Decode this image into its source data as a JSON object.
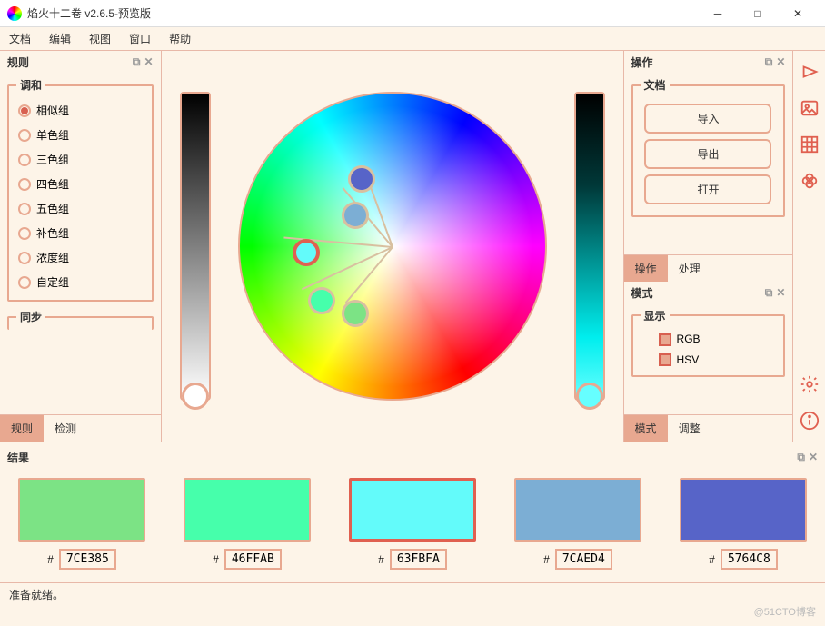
{
  "window": {
    "title": "焰火十二卷 v2.6.5-预览版"
  },
  "menu": {
    "file": "文档",
    "edit": "编辑",
    "view": "视图",
    "window": "窗口",
    "help": "帮助"
  },
  "rules": {
    "title": "规则",
    "harmony_legend": "调和",
    "options": [
      "相似组",
      "单色组",
      "三色组",
      "四色组",
      "五色组",
      "补色组",
      "浓度组",
      "自定组"
    ],
    "sync_legend": "同步",
    "tabs": {
      "rules": "规则",
      "detect": "检测"
    }
  },
  "ops": {
    "title": "操作",
    "doc_legend": "文档",
    "buttons": {
      "import": "导入",
      "export": "导出",
      "open": "打开"
    },
    "tabs": {
      "ops": "操作",
      "process": "处理"
    }
  },
  "mode": {
    "title": "模式",
    "display_legend": "显示",
    "rgb": "RGB",
    "hsv": "HSV",
    "tabs": {
      "mode": "模式",
      "adjust": "调整"
    }
  },
  "results": {
    "title": "结果",
    "swatches": [
      {
        "hex": "7CE385",
        "color": "#7CE385"
      },
      {
        "hex": "46FFAB",
        "color": "#46FFAB"
      },
      {
        "hex": "63FBFA",
        "color": "#63FBFA",
        "selected": true
      },
      {
        "hex": "7CAED4",
        "color": "#7CAED4"
      },
      {
        "hex": "5764C8",
        "color": "#5764C8"
      }
    ]
  },
  "status": {
    "text": "准备就绪。"
  },
  "watermark": "@51CTO博客"
}
